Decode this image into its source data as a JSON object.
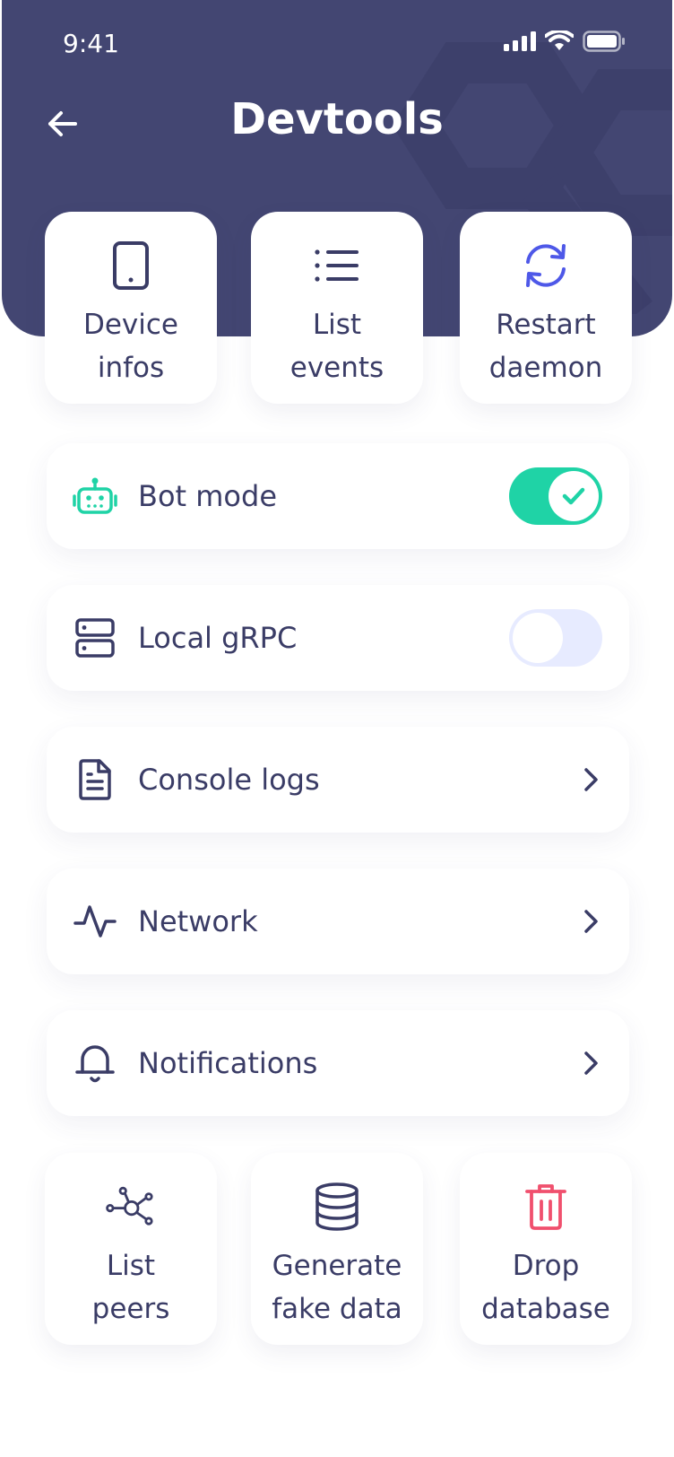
{
  "status_bar": {
    "time": "9:41"
  },
  "header": {
    "title": "Devtools"
  },
  "top_tiles": [
    {
      "label": "Device\ninfos",
      "icon": "smartphone-icon"
    },
    {
      "label": "List\nevents",
      "icon": "list-icon"
    },
    {
      "label": "Restart\ndaemon",
      "icon": "refresh-icon"
    }
  ],
  "rows": [
    {
      "label": "Bot mode",
      "icon": "robot-icon",
      "control": "toggle",
      "enabled": true
    },
    {
      "label": "Local gRPC",
      "icon": "server-icon",
      "control": "toggle",
      "enabled": false
    },
    {
      "label": "Console logs",
      "icon": "file-text-icon",
      "control": "chevron"
    },
    {
      "label": "Network",
      "icon": "activity-icon",
      "control": "chevron"
    },
    {
      "label": "Notifications",
      "icon": "bell-icon",
      "control": "chevron"
    }
  ],
  "bottom_tiles": [
    {
      "label": "List\npeers",
      "icon": "network-icon"
    },
    {
      "label": "Generate\nfake data",
      "icon": "database-icon"
    },
    {
      "label": "Drop\ndatabase",
      "icon": "trash-icon"
    }
  ],
  "colors": {
    "header_bg": "#434672",
    "text": "#3a3c66",
    "accent_blue": "#4e58e8",
    "accent_green": "#1fd3a6",
    "danger": "#f0506e",
    "toggle_off": "#e7ebff"
  }
}
